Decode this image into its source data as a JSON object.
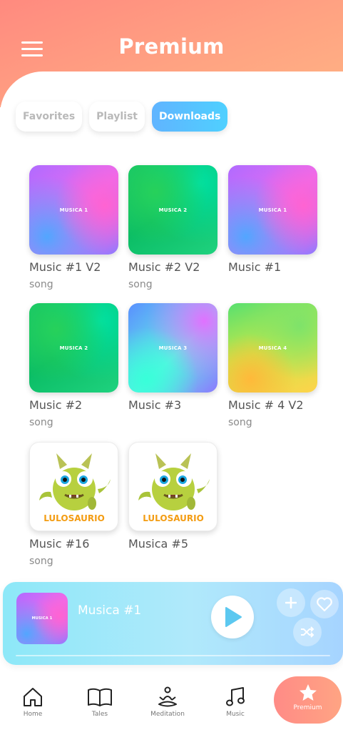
{
  "header": {
    "title": "Premium"
  },
  "tabs": [
    {
      "label": "Favorites",
      "active": false
    },
    {
      "label": "Playlist",
      "active": false
    },
    {
      "label": "Downloads",
      "active": true
    }
  ],
  "items": [
    {
      "title": "Music #1 V2",
      "subtitle": "song",
      "thumb_label": "MUSICA 1"
    },
    {
      "title": "Music #2 V2",
      "subtitle": "song",
      "thumb_label": "MUSICA 2"
    },
    {
      "title": "Music #1",
      "subtitle": "",
      "thumb_label": "MUSICA 1"
    },
    {
      "title": "Music #2",
      "subtitle": "song",
      "thumb_label": "MUSICA 2"
    },
    {
      "title": "Music #3",
      "subtitle": "",
      "thumb_label": "MUSICA 3"
    },
    {
      "title": "Music # 4 V2",
      "subtitle": "song",
      "thumb_label": "MUSICA 4"
    },
    {
      "title": "Music #16",
      "subtitle": "song",
      "thumb_label": "LULOSAURIO"
    },
    {
      "title": "Musica #5",
      "subtitle": "",
      "thumb_label": "LULOSAURIO"
    }
  ],
  "player": {
    "title": "Musica #1",
    "thumb_label": "MUSICA 1"
  },
  "nav": [
    {
      "label": "Home",
      "icon": "home-icon"
    },
    {
      "label": "Tales",
      "icon": "book-icon"
    },
    {
      "label": "Meditation",
      "icon": "meditation-icon"
    },
    {
      "label": "Music",
      "icon": "music-note-icon"
    },
    {
      "label": "Premium",
      "icon": "star-icon",
      "active": true
    }
  ],
  "colors": {
    "header_gradient": [
      "#ff8a7f",
      "#ffb384"
    ],
    "active_tab": "#4fc3ff",
    "player_bg": "#a6e4fb",
    "premium_nav": "#ff9484"
  }
}
